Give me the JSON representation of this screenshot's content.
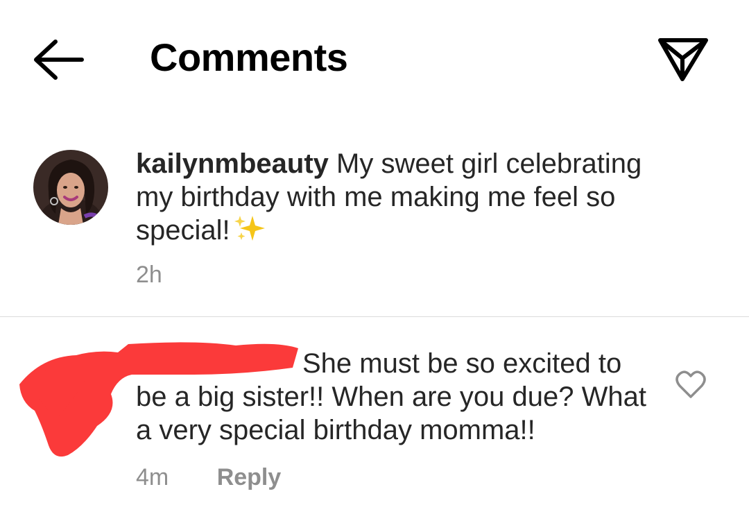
{
  "header": {
    "title": "Comments",
    "back_icon": "arrow-left-icon",
    "share_icon": "paper-plane-icon"
  },
  "caption": {
    "username": "kailynmbeauty",
    "text": "My sweet girl celebrating my birthday with me making me feel so special!",
    "emoji_icon": "sparkles-icon",
    "time": "2h"
  },
  "comment": {
    "username_redacted": true,
    "text_line1": "She must be so excited",
    "text_rest": "to be a big sister!! When are you due? What a very special birthday momma!!",
    "time": "4m",
    "reply_label": "Reply",
    "like_icon": "heart-outline-icon"
  },
  "colors": {
    "text": "#262626",
    "secondary": "#8e8e8e",
    "divider": "#dbdbdb",
    "redaction": "#fb3a3a",
    "sparkle": "#f5c518"
  }
}
